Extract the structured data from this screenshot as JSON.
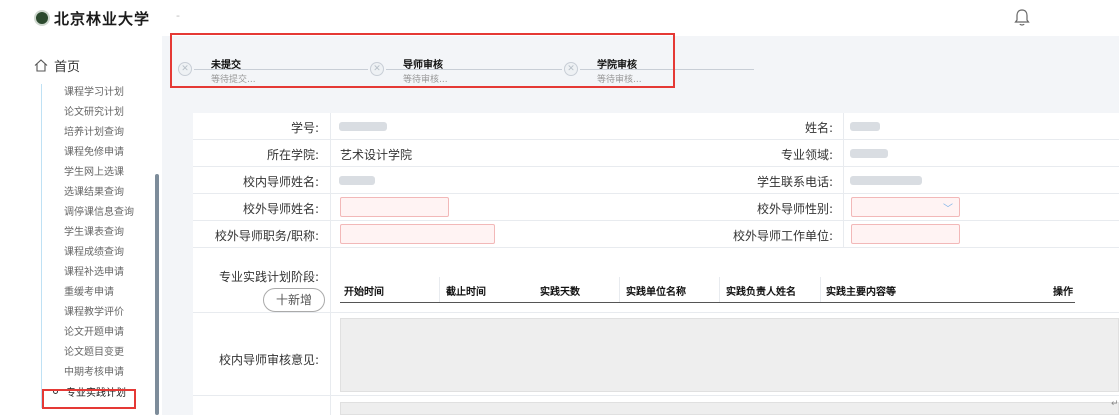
{
  "header": {
    "logo_text": "北京林业大学",
    "separator": "-"
  },
  "sidebar": {
    "home_label": "首页",
    "items": [
      "课程学习计划",
      "论文研究计划",
      "培养计划查询",
      "课程免修申请",
      "学生网上选课",
      "选课结果查询",
      "调停课信息查询",
      "学生课表查询",
      "课程成绩查询",
      "课程补选申请",
      "重缓考申请",
      "课程教学评价",
      "论文开题申请",
      "论文题目变更",
      "中期考核申请"
    ],
    "active_item": "专业实践计划"
  },
  "steps": [
    {
      "title": "未提交",
      "desc": "等待提交..."
    },
    {
      "title": "导师审核",
      "desc": "等待审核..."
    },
    {
      "title": "学院审核",
      "desc": "等待审核..."
    }
  ],
  "form": {
    "student_id_label": "学号:",
    "name_label": "姓名:",
    "college_label": "所在学院:",
    "college_value": "艺术设计学院",
    "major_label": "专业领域:",
    "inner_supervisor_label": "校内导师姓名:",
    "phone_label": "学生联系电话:",
    "outer_supervisor_label": "校外导师姓名:",
    "outer_gender_label": "校外导师性别:",
    "outer_title_label": "校外导师职务/职称:",
    "outer_unit_label": "校外导师工作单位:",
    "practice_stage_label": "专业实践计划阶段:",
    "add_button": "十新增",
    "inner_opinion_label": "校内导师审核意见:"
  },
  "table": {
    "headers": [
      "开始时间",
      "截止时间",
      "实践天数",
      "实践单位名称",
      "实践负责人姓名",
      "实践主要内容等",
      "操作"
    ]
  },
  "page_mark": "↵"
}
